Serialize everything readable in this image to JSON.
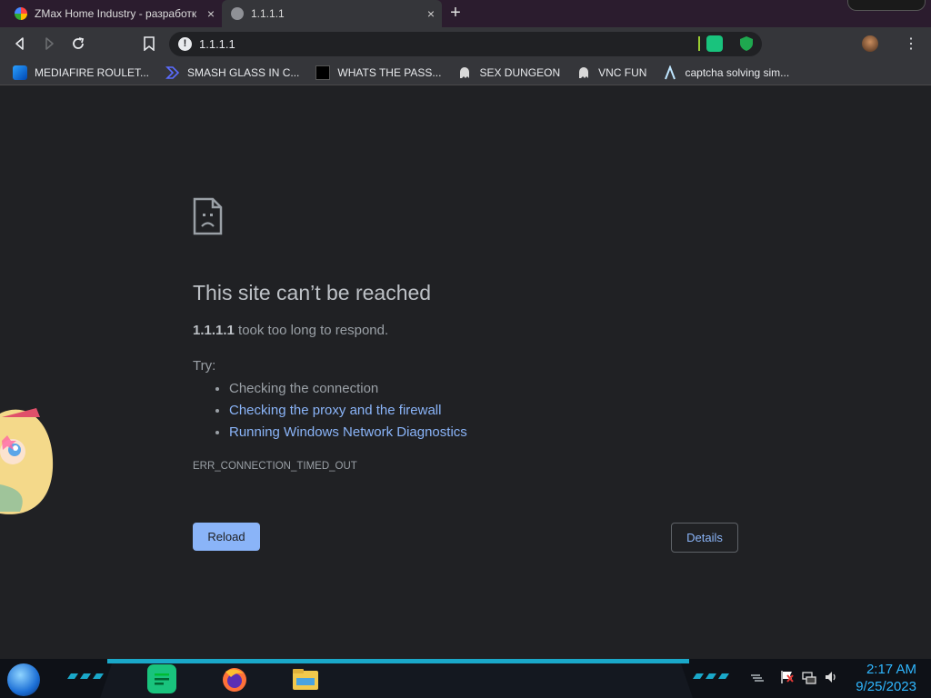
{
  "tabs": [
    {
      "title": "ZMax Home Industry - разработк",
      "close": "×"
    },
    {
      "title": "1.1.1.1",
      "close": "×"
    }
  ],
  "new_tab": "+",
  "omnibox": {
    "url": "1.1.1.1"
  },
  "menu_glyph": "⋮",
  "bookmarks": [
    {
      "label": "MEDIAFIRE ROULET..."
    },
    {
      "label": "SMASH GLASS IN C..."
    },
    {
      "label": "WHATS THE PASS..."
    },
    {
      "label": "SEX DUNGEON"
    },
    {
      "label": "VNC FUN"
    },
    {
      "label": "captcha solving sim..."
    }
  ],
  "error_page": {
    "heading": "This site can’t be reached",
    "host": "1.1.1.1",
    "message": " took too long to respond.",
    "try_label": "Try:",
    "suggestions": [
      {
        "text": "Checking the connection"
      },
      {
        "text": "Checking the proxy and the firewall"
      },
      {
        "text": "Running Windows Network Diagnostics"
      }
    ],
    "error_code": "ERR_CONNECTION_TIMED_OUT",
    "reload_label": "Reload",
    "details_label": "Details"
  },
  "taskbar": {
    "time": "2:17 AM",
    "date": "9/25/2023"
  },
  "colors": {
    "accent_link": "#8ab4f8",
    "page_bg": "#202124",
    "clock": "#2fb7ff"
  }
}
